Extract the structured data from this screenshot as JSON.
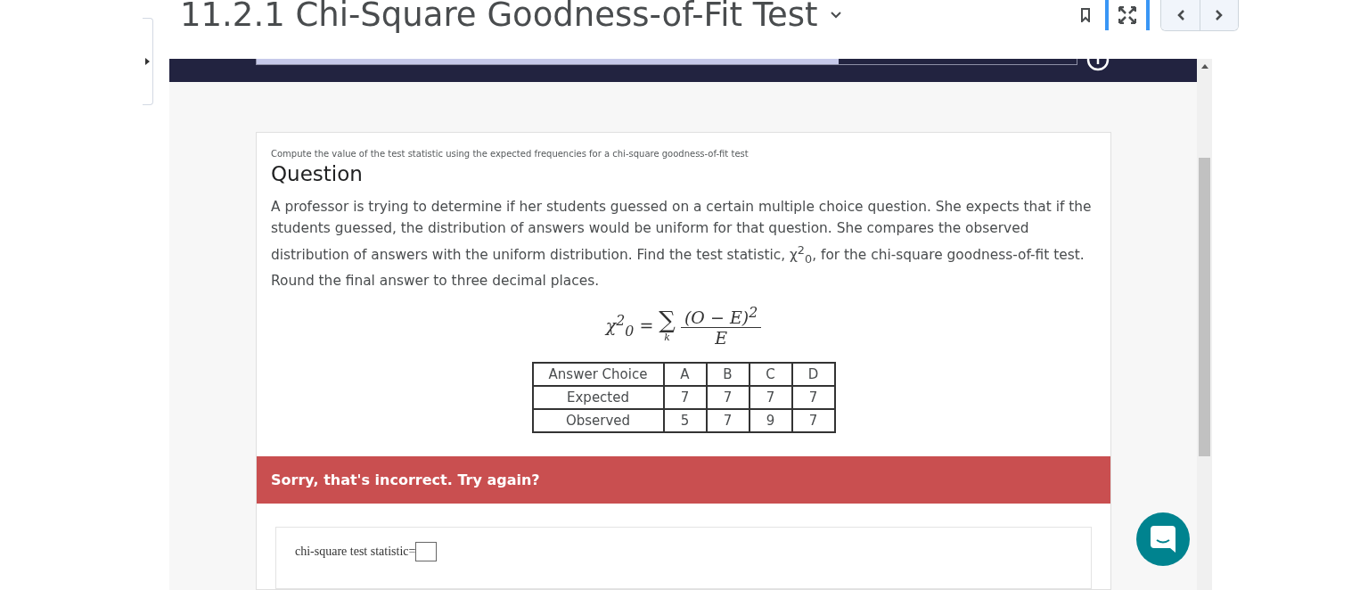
{
  "header": {
    "title": "11.2.1 Chi-Square Goodness-of-Fit Test"
  },
  "progress": {
    "level": 0.71
  },
  "question": {
    "subtitle": "Compute the value of the test statistic using the expected frequencies for a chi-square goodness-of-fit test",
    "heading": "Question",
    "body": "A professor is trying to determine if her students guessed on a certain multiple choice question. She expects that if the students guessed, the distribution of answers would be uniform for that question. She compares the observed distribution of answers with the uniform distribution. Find the test statistic, χ$^{2}$$_{0}$, for the chi-square goodness-of-fit test. Round the final answer to three decimal places.",
    "formula": {
      "lhs": "χ$^{2}$$_{0}$",
      "equals": "=",
      "sigma": "∑",
      "index": "k",
      "numerator": "(O − E)$^{2}$",
      "denominator": "E"
    },
    "table": [
      [
        "Answer Choice",
        "A",
        "B",
        "C",
        "D"
      ],
      [
        "Expected",
        "7",
        "7",
        "7",
        "7"
      ],
      [
        "Observed",
        "5",
        "7",
        "9",
        "7"
      ]
    ]
  },
  "feedback": {
    "message": "Sorry, that's incorrect. Try again?"
  },
  "answer": {
    "label": "chi-square test statistic="
  }
}
